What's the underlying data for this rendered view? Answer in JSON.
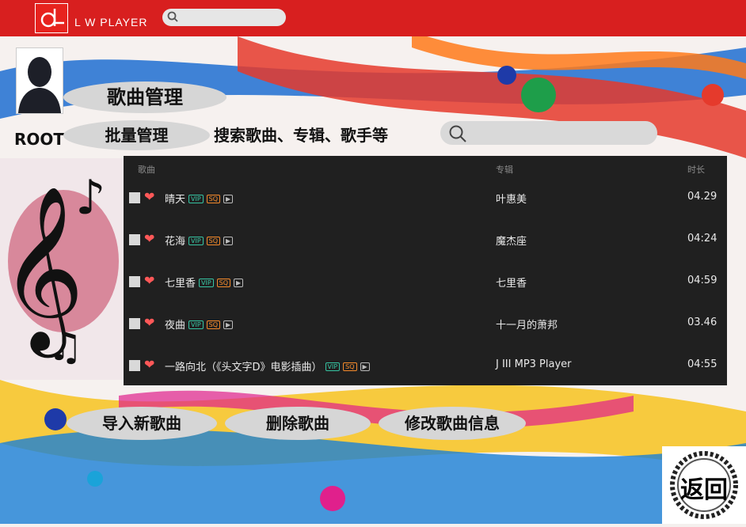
{
  "app": {
    "title": "L W PLAYER"
  },
  "user": {
    "name": "ROOT"
  },
  "page": {
    "title": "歌曲管理"
  },
  "actions": {
    "batch": "批量管理",
    "import": "导入新歌曲",
    "delete": "删除歌曲",
    "edit": "修改歌曲信息",
    "back": "返回"
  },
  "search": {
    "hint": "搜索歌曲、专辑、歌手等"
  },
  "table": {
    "headers": {
      "song": "歌曲",
      "album": "专辑",
      "duration": "时长"
    },
    "badges": {
      "vip": "VIP",
      "sq": "SQ",
      "mv": "▶"
    },
    "rows": [
      {
        "name": "晴天",
        "album": "叶惠美",
        "duration": "04.29"
      },
      {
        "name": "花海",
        "album": "魔杰座",
        "duration": "04:24"
      },
      {
        "name": "七里香",
        "album": "七里香",
        "duration": "04:59"
      },
      {
        "name": "夜曲",
        "album": "十一月的萧邦",
        "duration": "03.46"
      },
      {
        "name": "一路向北（《头文字D》电影插曲）",
        "album": "J III MP3 Player",
        "duration": "04:55"
      }
    ]
  },
  "colors": {
    "topbar": "#d81f1f",
    "table_bg": "#202020",
    "heart": "#ff5858",
    "vip": "#36c4a2",
    "sq": "#f58a2b"
  }
}
